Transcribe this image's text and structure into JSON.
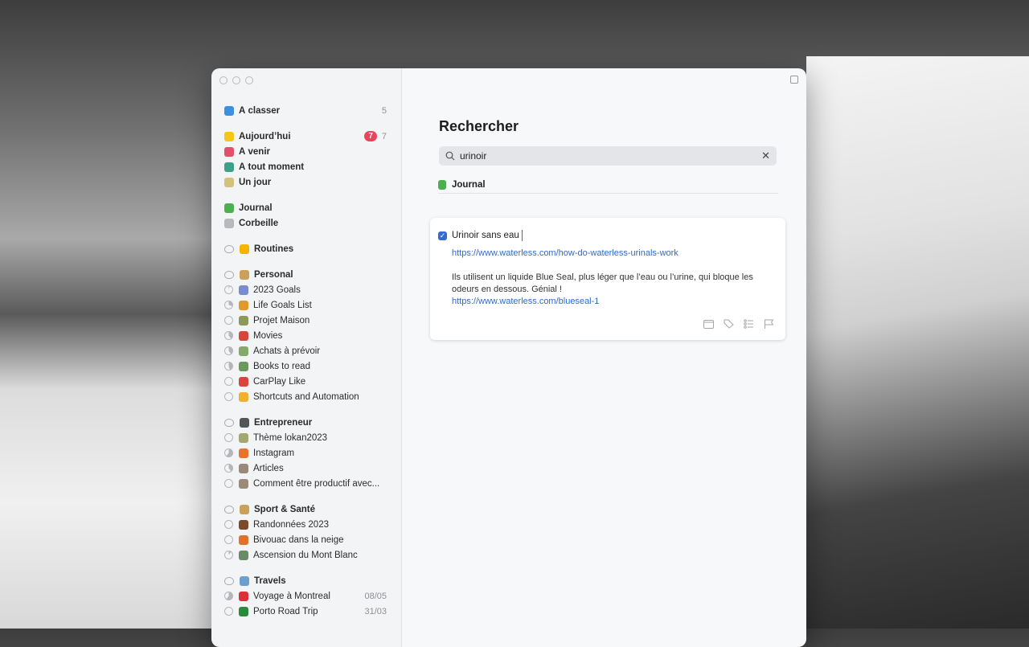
{
  "window": {
    "title": ""
  },
  "sidebar": {
    "groups": [
      {
        "items": [
          {
            "label": "À classer",
            "icon": "inbox-icon",
            "color": "#3d8fe0",
            "count": "5"
          }
        ]
      },
      {
        "items": [
          {
            "label": "Aujourd’hui",
            "icon": "star-icon",
            "color": "#f5c518",
            "badge": "7",
            "count": "7"
          },
          {
            "label": "À venir",
            "icon": "calendar-icon",
            "color": "#e3506a"
          },
          {
            "label": "À tout moment",
            "icon": "layers-icon",
            "color": "#3fa08a"
          },
          {
            "label": "Un jour",
            "icon": "archive-box-icon",
            "color": "#d4c27a"
          }
        ]
      },
      {
        "items": [
          {
            "label": "Journal",
            "icon": "logbook-icon",
            "color": "#4caf50"
          },
          {
            "label": "Corbeille",
            "icon": "trash-icon",
            "color": "#b8b9bd"
          }
        ]
      },
      {
        "area": {
          "label": "Routines",
          "emoji": "sun-emoji",
          "color": "#f4b400"
        },
        "items": []
      },
      {
        "area": {
          "label": "Personal",
          "emoji": "technologist-emoji",
          "color": "#c9a15a"
        },
        "items": [
          {
            "label": "2023 Goals",
            "emoji": "rocket-emoji",
            "color": "#7a8ccf",
            "progress": 0.05
          },
          {
            "label": "Life Goals List",
            "emoji": "star-struck-emoji",
            "color": "#e09a2b",
            "progress": 0.3
          },
          {
            "label": "Projet Maison",
            "emoji": "house-emoji",
            "color": "#8b9a5b",
            "progress": 0
          },
          {
            "label": "Movies",
            "emoji": "popcorn-emoji",
            "color": "#d9453b",
            "progress": 0.4
          },
          {
            "label": "Achats à prévoir",
            "emoji": "money-emoji",
            "color": "#86a86a",
            "progress": 0.4
          },
          {
            "label": "Books to read",
            "emoji": "books-emoji",
            "color": "#6a9a5a",
            "progress": 0.45
          },
          {
            "label": "CarPlay Like",
            "emoji": "car-emoji",
            "color": "#d9453b",
            "progress": 0
          },
          {
            "label": "Shortcuts and Automation",
            "emoji": "nerd-face-emoji",
            "color": "#f0b030",
            "progress": 0
          }
        ]
      },
      {
        "area": {
          "label": "Entrepreneur",
          "emoji": "video-camera-emoji",
          "color": "#555"
        },
        "items": [
          {
            "label": "Thème lokan2023",
            "emoji": "picture-emoji",
            "color": "#a4a870",
            "progress": 0
          },
          {
            "label": "Instagram",
            "emoji": "sunset-emoji",
            "color": "#e8732a",
            "progress": 0.6
          },
          {
            "label": "Articles",
            "emoji": "technologist-emoji",
            "color": "#9a8a7a",
            "progress": 0.4
          },
          {
            "label": "Comment être productif avec...",
            "emoji": "technologist-emoji",
            "color": "#9a8a7a",
            "progress": 0
          }
        ]
      },
      {
        "area": {
          "label": "Sport & Santé",
          "emoji": "weightlifter-emoji",
          "color": "#c9a15a"
        },
        "items": [
          {
            "label": "Randonnées 2023",
            "emoji": "hiking-boot-emoji",
            "color": "#7a4a2a",
            "progress": 0
          },
          {
            "label": "Bivouac dans la neige",
            "emoji": "tent-emoji",
            "color": "#e0702a",
            "progress": 0
          },
          {
            "label": "Ascension du Mont Blanc",
            "emoji": "mountain-emoji",
            "color": "#6a8a6a",
            "progress": 0.1
          }
        ]
      },
      {
        "area": {
          "label": "Travels",
          "emoji": "airplane-emoji",
          "color": "#6aa0d0"
        },
        "items": [
          {
            "label": "Voyage à Montreal",
            "emoji": "canada-flag-emoji",
            "color": "#d9303a",
            "progress": 0.6,
            "date": "08/05"
          },
          {
            "label": "Porto Road Trip",
            "emoji": "portugal-flag-emoji",
            "color": "#2a8a3a",
            "progress": 0,
            "date": "31/03"
          }
        ]
      }
    ]
  },
  "main": {
    "title": "Rechercher",
    "search": {
      "value": "urinoir",
      "icon": "search-icon"
    },
    "section": {
      "label": "Journal",
      "icon": "logbook-icon"
    },
    "task": {
      "title": "Urinoir sans eau",
      "completed": true,
      "link1": "https://www.waterless.com/how-do-waterless-urinals-work",
      "text": "Ils utilisent un liquide Blue Seal, plus léger que l’eau ou l’urine, qui bloque les odeurs en dessous. Génial !",
      "link2": "https://www.waterless.com/blueseal-1",
      "tools": [
        "calendar-icon",
        "tag-icon",
        "checklist-icon",
        "flag-icon"
      ]
    }
  },
  "colors": {
    "accent": "#3669d6",
    "badge": "#e6455c",
    "link": "#2f6ad0"
  }
}
